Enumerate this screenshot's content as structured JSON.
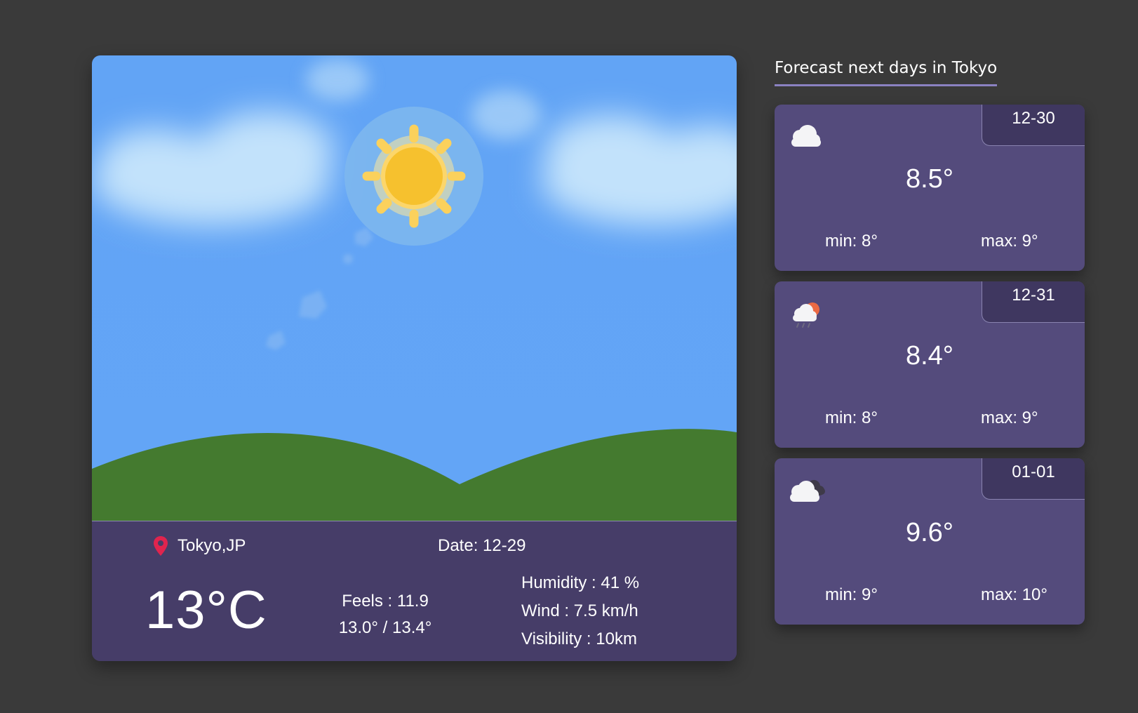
{
  "current": {
    "location": "Tokyo,JP",
    "date": "Date: 12-29",
    "temperature": "13°C",
    "feels": "Feels :  11.9",
    "min_max": "13.0° / 13.4°",
    "humidity": "Humidity :  41 %",
    "wind": "Wind :  7.5 km/h",
    "visibility": "Visibility :  10km",
    "scene": "sunny-icon"
  },
  "forecast": {
    "title": "Forecast next days in Tokyo",
    "days": [
      {
        "date": "12-30",
        "temp": "8.5°",
        "min": "min: 8°",
        "max": "max: 9°",
        "icon": "cloud-icon"
      },
      {
        "date": "12-31",
        "temp": "8.4°",
        "min": "min: 8°",
        "max": "max: 9°",
        "icon": "cloud-sun-rain-icon"
      },
      {
        "date": "01-01",
        "temp": "9.6°",
        "min": "min: 9°",
        "max": "max: 10°",
        "icon": "dark-cloud-icon"
      }
    ]
  },
  "colors": {
    "page_background": "#3a3a3a",
    "sky": "#62a4f5",
    "hills": "#447a2f",
    "info_panel": "#463d68",
    "forecast_card": "#544b7c",
    "forecast_date_tab": "#3f3760",
    "sun": "#f6c12e",
    "pin": "#e0244e"
  }
}
